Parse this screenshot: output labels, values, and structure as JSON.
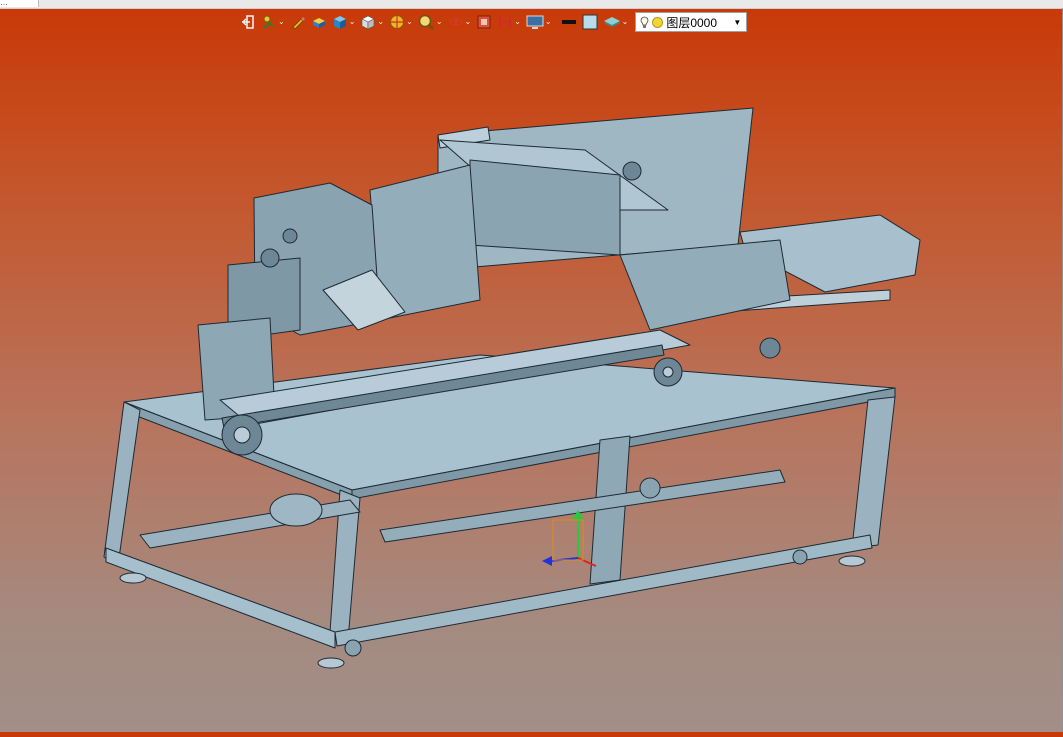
{
  "tab": {
    "label": "…"
  },
  "toolbar": {
    "buttons": [
      {
        "name": "exit-sketch-icon",
        "dropdown": false
      },
      {
        "name": "assembly-icon",
        "dropdown": true
      },
      {
        "name": "pencil-icon",
        "dropdown": false
      },
      {
        "name": "solid-block-icon",
        "dropdown": false
      },
      {
        "name": "display-style-icon",
        "dropdown": true
      },
      {
        "name": "standard-view-icon",
        "dropdown": true
      },
      {
        "name": "render-icon",
        "dropdown": true
      },
      {
        "name": "zoom-icon",
        "dropdown": true
      },
      {
        "name": "orbit-icon",
        "dropdown": true
      },
      {
        "name": "section-icon",
        "dropdown": false
      },
      {
        "name": "measure-icon",
        "dropdown": true
      },
      {
        "name": "monitor-icon",
        "dropdown": true
      },
      {
        "name": "line-color-icon",
        "dropdown": false
      },
      {
        "name": "face-color-icon",
        "dropdown": false
      },
      {
        "name": "layer-stack-icon",
        "dropdown": true
      }
    ],
    "layer_select": {
      "value": "图层0000",
      "bulb": "lightbulb-icon",
      "color": "#f1d635"
    }
  },
  "viewport": {
    "gradient_top": "#c93806",
    "gradient_bottom": "#a18f88",
    "model_color": "#9bb3c0",
    "edge_color": "#1c2a33"
  }
}
